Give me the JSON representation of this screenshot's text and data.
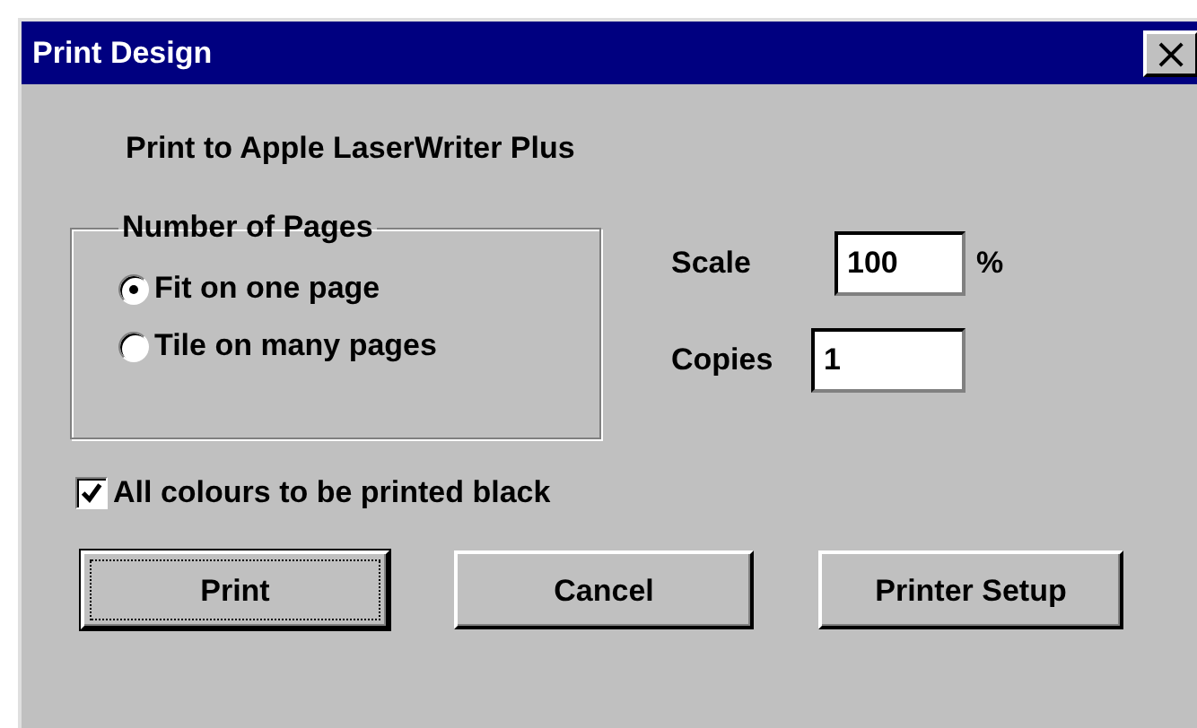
{
  "window": {
    "title": "Print Design",
    "close": "×"
  },
  "printer_label": "Print to Apple LaserWriter Plus",
  "number_of_pages": {
    "title": "Number of Pages",
    "options": [
      {
        "label": "Fit on one page",
        "selected": true
      },
      {
        "label": "Tile on many pages",
        "selected": false
      }
    ]
  },
  "scale": {
    "label": "Scale",
    "value": "100",
    "unit": "%"
  },
  "copies": {
    "label": "Copies",
    "value": "1"
  },
  "black_checkbox": {
    "label": "All colours to be printed black",
    "checked": true
  },
  "buttons": [
    {
      "label": "Print",
      "default": true
    },
    {
      "label": "Cancel",
      "default": false
    },
    {
      "label": "Printer Setup",
      "default": false
    }
  ]
}
